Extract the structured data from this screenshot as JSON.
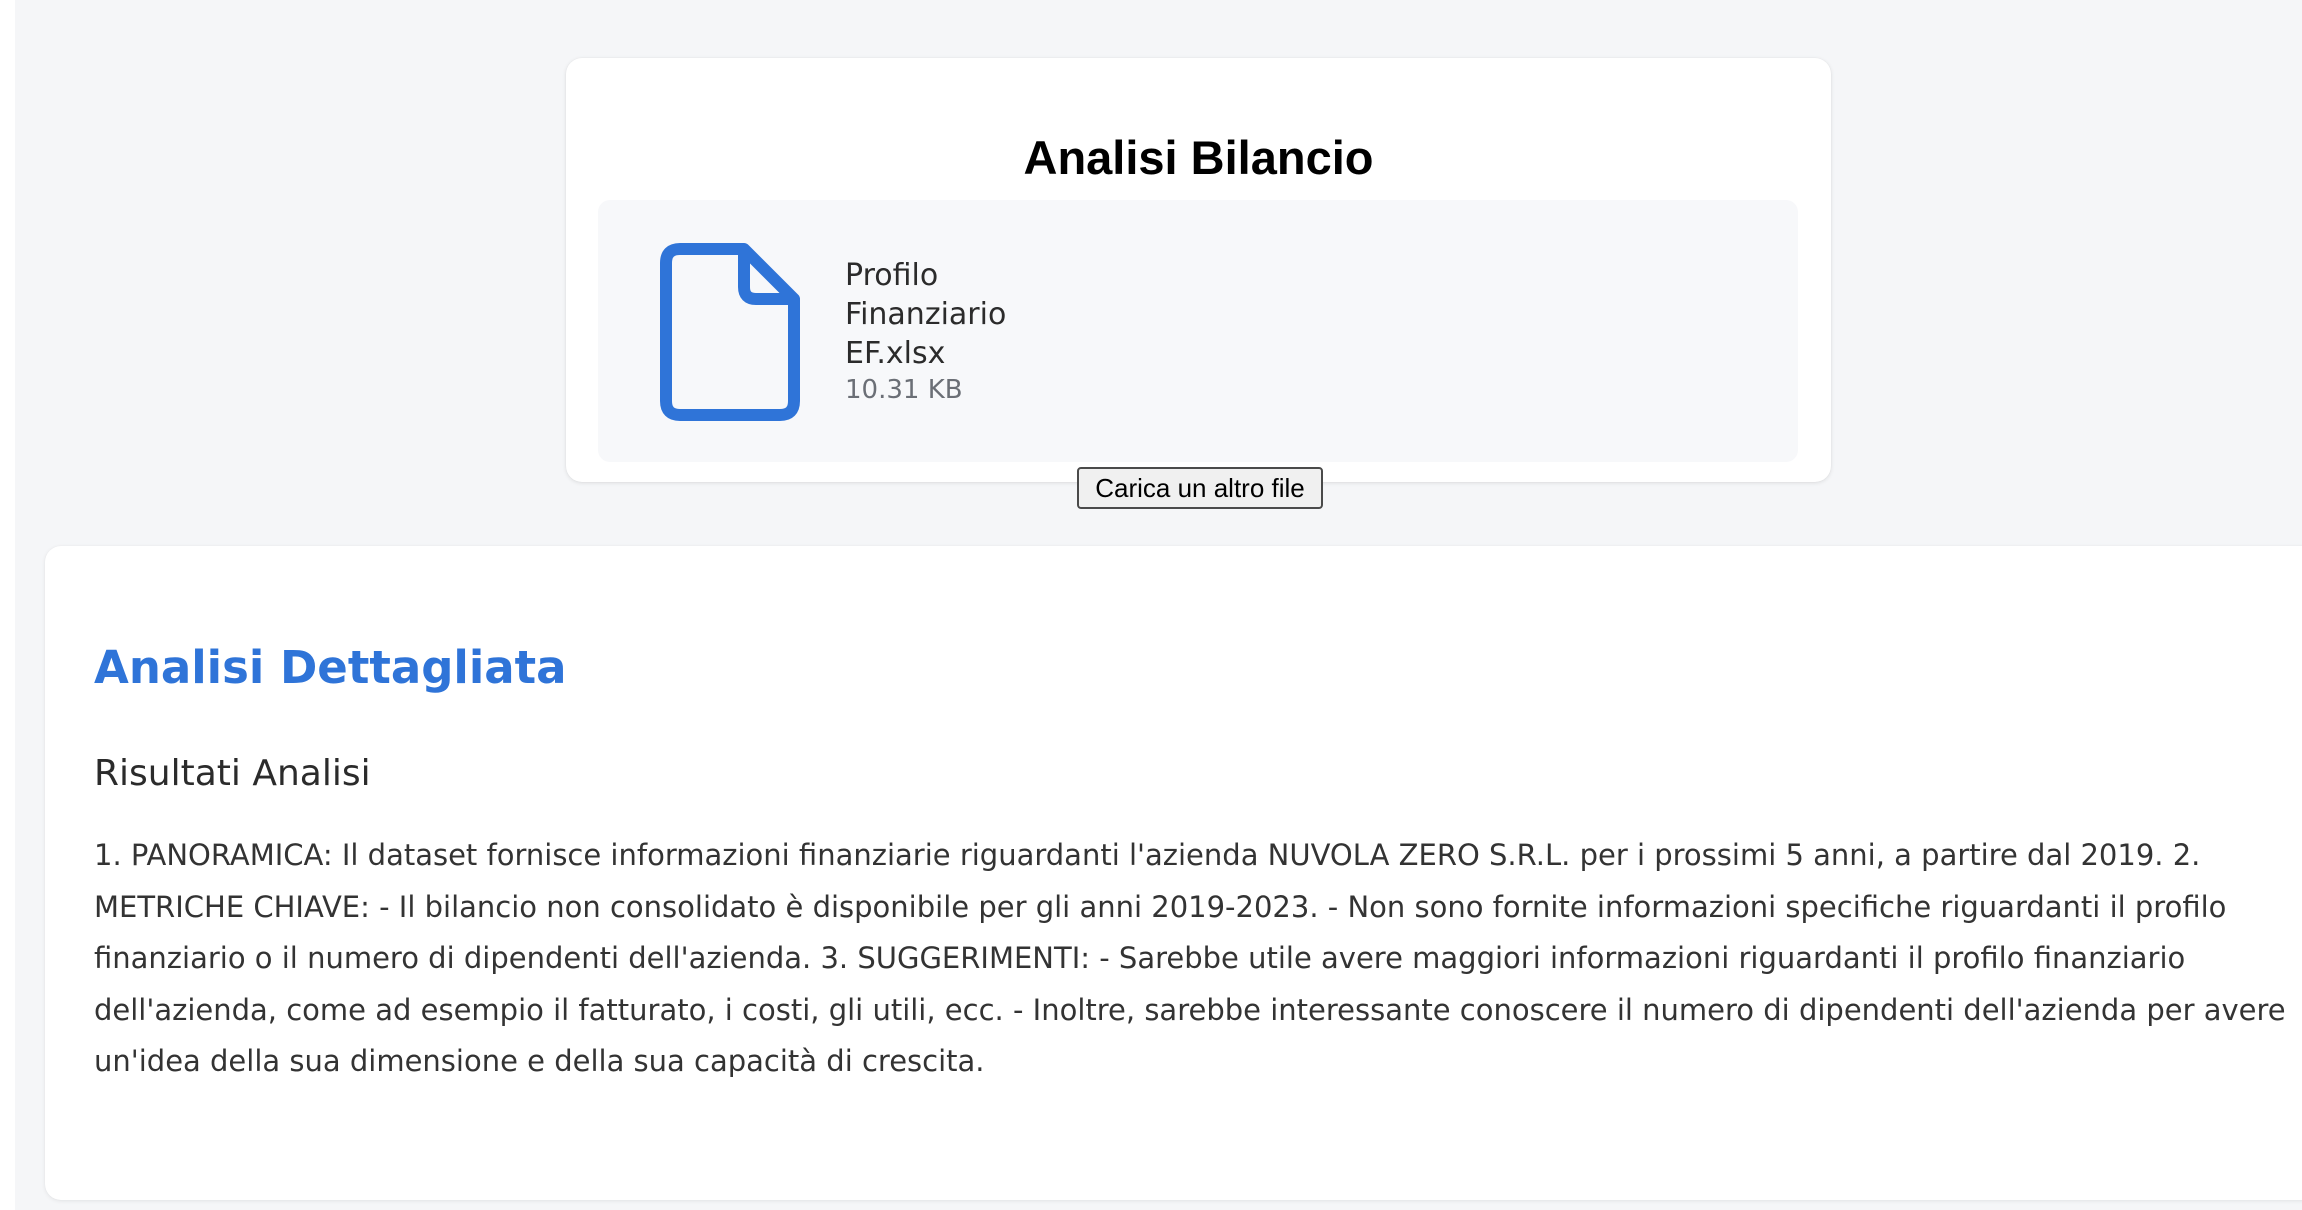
{
  "upload": {
    "title": "Analisi Bilancio",
    "file": {
      "name": "Profilo Finanziario EF.xlsx",
      "size": "10.31 KB",
      "icon": "document-icon"
    },
    "reupload_label": "Carica un altro file"
  },
  "analysis": {
    "title": "Analisi Dettagliata",
    "results_heading": "Risultati Analisi",
    "results_text": "1. PANORAMICA: Il dataset fornisce informazioni finanziarie riguardanti l'azienda NUVOLA ZERO S.R.L. per i prossimi 5 anni, a partire dal 2019. 2. METRICHE CHIAVE: - Il bilancio non consolidato è disponibile per gli anni 2019-2023. - Non sono fornite informazioni specifiche riguardanti il profilo finanziario o il numero di dipendenti dell'azienda. 3. SUGGERIMENTI: - Sarebbe utile avere maggiori informazioni riguardanti il profilo finanziario dell'azienda, come ad esempio il fatturato, i costi, gli utili, ecc. - Inoltre, sarebbe interessante conoscere il numero di dipendenti dell'azienda per avere un'idea della sua dimensione e della sua capacità di crescita."
  },
  "colors": {
    "accent": "#2f74d8",
    "background": "#f5f6f8",
    "card": "#ffffff",
    "file_box": "#f7f8fa"
  }
}
